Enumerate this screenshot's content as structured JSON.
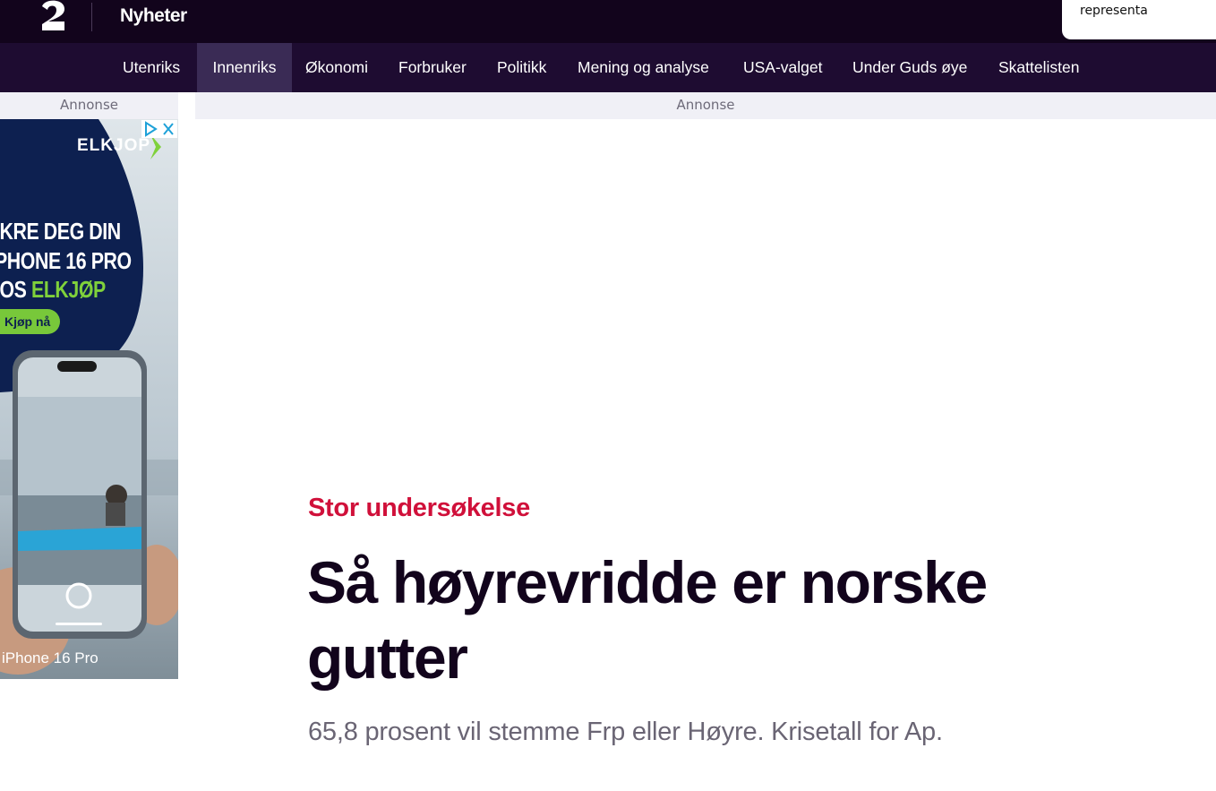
{
  "header": {
    "logo_alt": "TV 2",
    "section_title": "Nyheter",
    "popup_text": "representa"
  },
  "nav": {
    "items": [
      {
        "label": "Utenriks",
        "active": false
      },
      {
        "label": "Innenriks",
        "active": true
      },
      {
        "label": "Økonomi",
        "active": false
      },
      {
        "label": "Forbruker",
        "active": false
      },
      {
        "label": "Politikk",
        "active": false
      },
      {
        "label": "Mening og analyse",
        "active": false
      },
      {
        "label": "USA-valget",
        "active": false
      },
      {
        "label": "Under Guds øye",
        "active": false
      },
      {
        "label": "Skattelisten",
        "active": false
      }
    ]
  },
  "ads": {
    "label_left": "Annonse",
    "label_main": "Annonse",
    "side_ad": {
      "brand": "ELKJOP",
      "line1": "IKRE DEG DIN",
      "line2": "PHONE 16 PRO",
      "line3_prefix": "IOS ",
      "line3_highlight": "ELKJØP",
      "cta": "Kjøp nå",
      "product_label": "iPhone 16 Pro",
      "colors": {
        "navy": "#0d2050",
        "green": "#7fd13b"
      }
    }
  },
  "article": {
    "kicker": "Stor undersøkelse",
    "headline": "Så høyrevridde er norske gutter",
    "lede": "65,8 prosent vil stemme Frp eller Høyre. Krisetall for Ap."
  },
  "colors": {
    "topbar": "#12041c",
    "navbar": "#1e0c31",
    "nav_active": "#3a2b55",
    "kicker": "#d0103a"
  }
}
